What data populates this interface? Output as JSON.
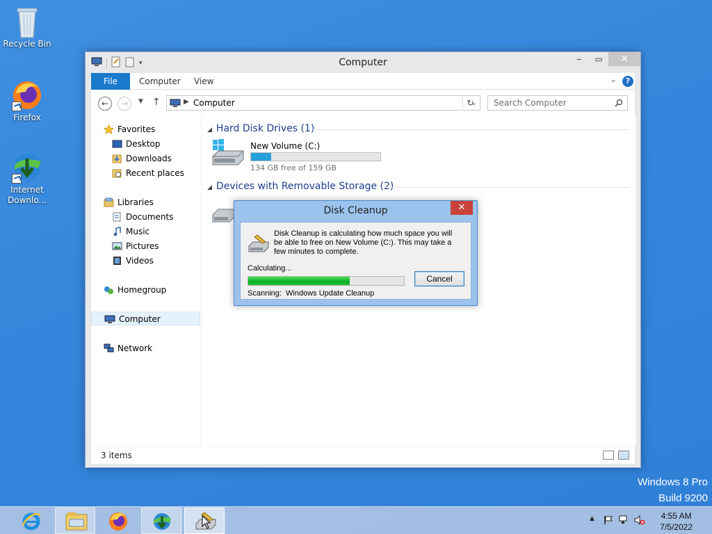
{
  "desktop": {
    "icons": [
      {
        "label": "Recycle Bin"
      },
      {
        "label": "Firefox"
      },
      {
        "label": "Internet Downlo..."
      }
    ],
    "watermark": {
      "line1": "Windows 8 Pro",
      "line2": "Build 9200"
    }
  },
  "explorer": {
    "title": "Computer",
    "ribbon": {
      "file": "File",
      "computer": "Computer",
      "view": "View",
      "help": "?"
    },
    "address": {
      "path": "Computer",
      "search_placeholder": "Search Computer"
    },
    "nav": {
      "favorites": "Favorites",
      "desktop": "Desktop",
      "downloads": "Downloads",
      "recent": "Recent places",
      "libraries": "Libraries",
      "documents": "Documents",
      "music": "Music",
      "pictures": "Pictures",
      "videos": "Videos",
      "homegroup": "Homegroup",
      "computer": "Computer",
      "network": "Network"
    },
    "groups": {
      "hdd": "Hard Disk Drives (1)",
      "removable": "Devices with Removable Storage (2)"
    },
    "drive_c": {
      "name": "New Volume (C:)",
      "free_text": "134 GB free of 159 GB",
      "used_fraction": 0.157
    },
    "status": "3 items"
  },
  "dialog": {
    "title": "Disk Cleanup",
    "message": "Disk Cleanup is calculating how much space you will be able to free on New Volume (C:). This may take a few minutes to complete.",
    "calculating": "Calculating...",
    "progress_fraction": 0.65,
    "scanning": "Scanning:  Windows Update Cleanup",
    "cancel": "Cancel"
  },
  "taskbar": {
    "time": "4:55 AM",
    "date": "7/5/2022",
    "apps": [
      "internet-explorer",
      "file-explorer",
      "firefox",
      "internet-download-manager",
      "disk-cleanup"
    ]
  },
  "colors": {
    "accent": "#1979ca",
    "progress": "#06b025",
    "drive_bar": "#26a0da"
  }
}
